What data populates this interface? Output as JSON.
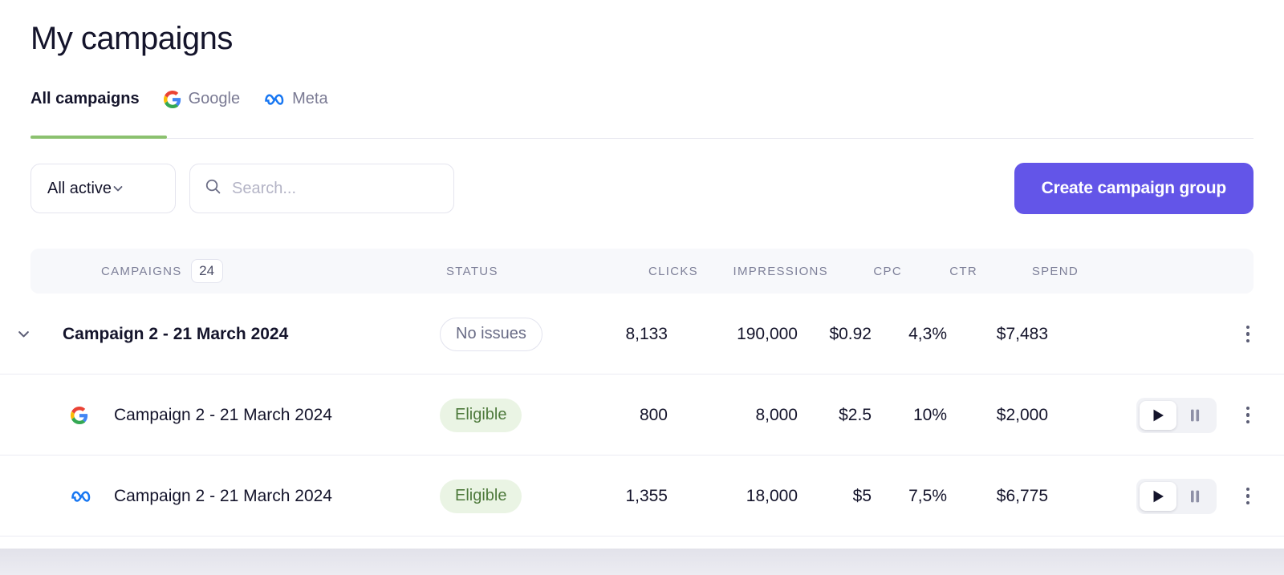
{
  "header": {
    "title": "My campaigns",
    "tabs": [
      {
        "label": "All campaigns",
        "icon": "none",
        "active": true
      },
      {
        "label": "Google",
        "icon": "google-icon",
        "active": false
      },
      {
        "label": "Meta",
        "icon": "meta-icon",
        "active": false
      }
    ],
    "active_tab_color": "#8bc16f"
  },
  "controls": {
    "filter": {
      "value": "All active",
      "icon": "chevron-down-icon"
    },
    "search": {
      "value": "",
      "placeholder": "Search...",
      "icon": "search-icon"
    },
    "cta": {
      "label": "Create campaign group",
      "color": "#6355e8"
    }
  },
  "table": {
    "columns": {
      "campaigns": "CAMPAIGNS",
      "campaigns_count": "24",
      "status": "STATUS",
      "clicks": "CLICKS",
      "impressions": "IMPRESSIONS",
      "cpc": "CPC",
      "ctr": "CTR",
      "spend": "SPEND"
    },
    "rows": [
      {
        "name": "Campaign 2 - 21 March 2024",
        "status": "No issues",
        "clicks": "8,133",
        "impressions": "190,000",
        "cpc": "$0.92",
        "ctr": "4,3%",
        "spend": "$7,483"
      },
      {
        "name": "Campaign 2 - 21 March 2024",
        "status": "Eligible",
        "clicks": "800",
        "impressions": "8,000",
        "cpc": "$2.5",
        "ctr": "10%",
        "spend": "$2,000"
      },
      {
        "name": "Campaign 2 - 21 March 2024",
        "status": "Eligible",
        "clicks": "1,355",
        "impressions": "18,000",
        "cpc": "$5",
        "ctr": "7,5%",
        "spend": "$6,775"
      }
    ]
  }
}
